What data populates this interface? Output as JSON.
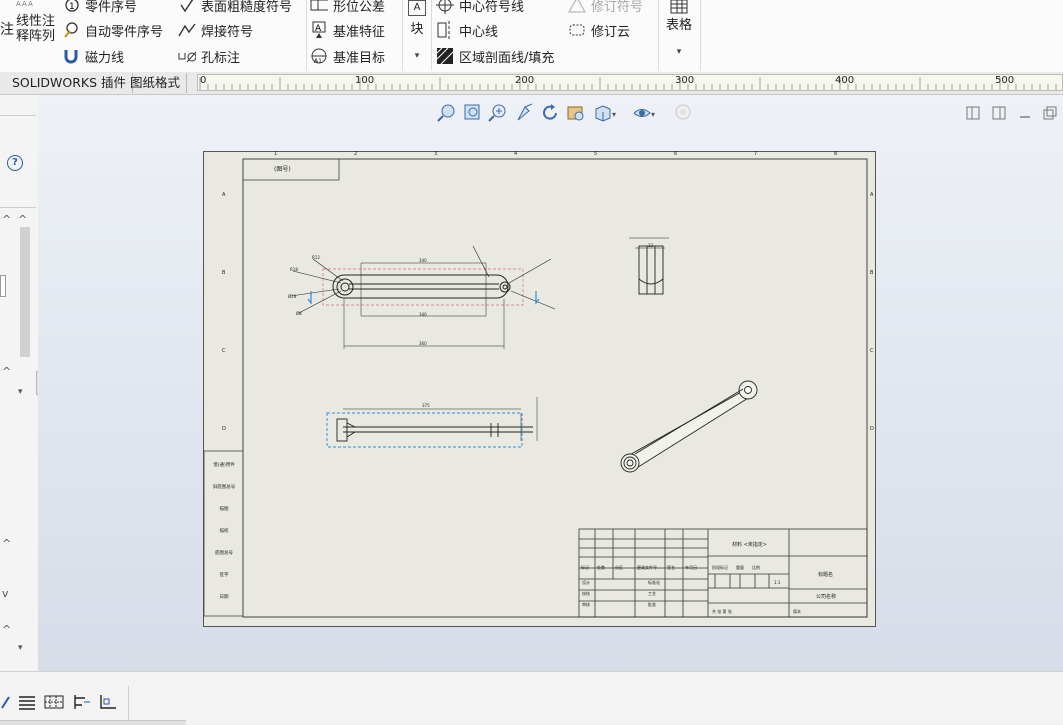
{
  "ribbon": {
    "col0": {
      "partial_label": "注",
      "pattern_line1": "线性注",
      "pattern_line2": "释阵列"
    },
    "col1": {
      "balloon": "零件序号",
      "auto_balloon": "自动零件序号",
      "magnetic_line": "磁力线"
    },
    "col2": {
      "surface_finish": "表面粗糙度符号",
      "weld_symbol": "焊接符号",
      "hole_callout": "孔标注"
    },
    "col3": {
      "geometric_tolerance": "形位公差",
      "datum_feature": "基准特征",
      "datum_target": "基准目标"
    },
    "col4": {
      "block": "块",
      "block_sub": "A"
    },
    "col5": {
      "center_mark": "中心符号线",
      "centerline": "中心线",
      "area_hatch": "区域剖面线/填充"
    },
    "col6": {
      "revision_symbol": "修订符号",
      "revision_cloud": "修订云"
    },
    "col7": {
      "tables": "表格"
    }
  },
  "tabs": [
    {
      "label": "SOLIDWORKS 插件"
    },
    {
      "label": "图纸格式"
    }
  ],
  "ruler": {
    "ticks": [
      "0",
      "100",
      "200",
      "300",
      "400",
      "500"
    ]
  },
  "sheet": {
    "zone_cols": [
      "1",
      "2",
      "3",
      "4",
      "5",
      "6",
      "7",
      "8"
    ],
    "zone_rows": [
      "A",
      "B",
      "C",
      "D",
      "E"
    ],
    "top_label": "(图号)",
    "left_block_rows": [
      "借(通)用件",
      "旧底图总号",
      "描图",
      "描校",
      "底图总号",
      "签字",
      "日期"
    ],
    "drawing_labels": {
      "top_overall_len": "340",
      "bottom_overall_len": "360",
      "side_width": "12",
      "lower_view_len": "375",
      "radius_a": "R18",
      "radius_b": "R12",
      "dia_a": "Ø16",
      "dia_b": "Ø8"
    },
    "title_block": {
      "material": "材料 <未指定>",
      "drawing_name": "标题名",
      "company": "公司名称",
      "row_headers": [
        "标记",
        "处数",
        "分区",
        "更改文件号",
        "签名",
        "年月日"
      ],
      "roles": [
        "设计",
        "校核",
        "审核",
        "工艺"
      ],
      "std": "标准化",
      "approve": "批准",
      "phase_labels": [
        "阶段标记",
        "重量",
        "比例"
      ],
      "sheet_count": "共 张 第 张",
      "scale": "1:1",
      "version": "版本"
    }
  },
  "status": {
    "icons": [
      "smart-dimension-icon",
      "note-icon",
      "hatch-icon",
      "align-icon",
      "coord-icon"
    ]
  }
}
